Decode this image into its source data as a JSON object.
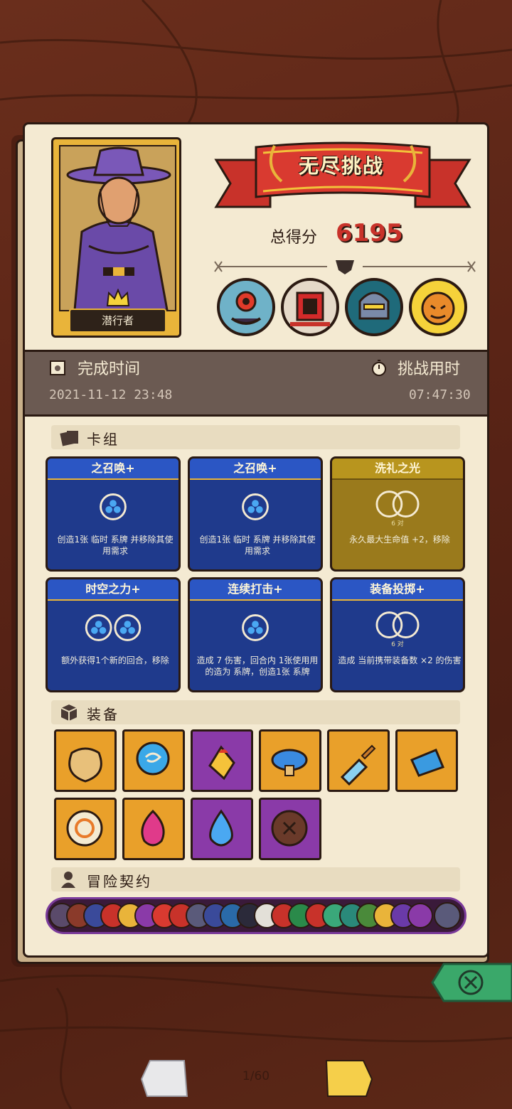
{
  "hero": {
    "name": "潜行者"
  },
  "banner": {
    "title": "无尽挑战"
  },
  "score": {
    "label": "总得分",
    "value": "6195"
  },
  "bosses": [
    "cyclops-boss-icon",
    "drum-demon-boss-icon",
    "armored-knight-boss-icon",
    "pumpkin-sun-boss-icon"
  ],
  "time": {
    "finish_label": "完成时间",
    "finish_value": "2021-11-12 23:48",
    "used_label": "挑战用时",
    "used_value": "07:47:30"
  },
  "sections": {
    "deck": "卡组",
    "equipment": "装备",
    "contracts": "冒险契约"
  },
  "cards": [
    {
      "title": "之召唤+",
      "desc": "创造1张 临时 系牌 并移除其使用需求",
      "type": "blue",
      "orbs": 1
    },
    {
      "title": "之召唤+",
      "desc": "创造1张 临时 系牌 并移除其使用需求",
      "type": "blue",
      "orbs": 1
    },
    {
      "title": "洗礼之光",
      "desc": "永久最大生命值 +2，移除",
      "type": "gold",
      "orbs": 2,
      "note": "6 对"
    },
    {
      "title": "时空之力+",
      "desc": "额外获得1个新的回合，移除",
      "type": "blue",
      "orbs": 2
    },
    {
      "title": "连续打击+",
      "desc": "造成 7 伤害，回合内 1张使用用的造为 系牌，创造1张 系牌",
      "type": "blue",
      "orbs": 1
    },
    {
      "title": "装备投掷+",
      "desc": "造成 当前携带装备数 ×2 的伤害",
      "type": "gold-blue",
      "orbs": 2,
      "note": "6 对"
    }
  ],
  "equipment": [
    {
      "name": "money-bag-icon",
      "color": "orange"
    },
    {
      "name": "blue-orb-ring-icon",
      "color": "orange"
    },
    {
      "name": "fire-gem-icon",
      "color": "purple"
    },
    {
      "name": "blue-mushroom-icon",
      "color": "orange"
    },
    {
      "name": "crystal-dagger-icon",
      "color": "orange"
    },
    {
      "name": "ice-crystal-icon",
      "color": "orange"
    },
    {
      "name": "gold-ring-icon",
      "color": "orange"
    },
    {
      "name": "pink-flame-icon",
      "color": "orange"
    },
    {
      "name": "water-drop-icon",
      "color": "purple"
    },
    {
      "name": "wooden-shield-icon",
      "color": "purple"
    }
  ],
  "pagination": {
    "label": "1/60"
  },
  "colors": {
    "accent_red": "#c8322a",
    "blue_card": "#1f3a8c",
    "gold_card": "#9a7a1c"
  }
}
